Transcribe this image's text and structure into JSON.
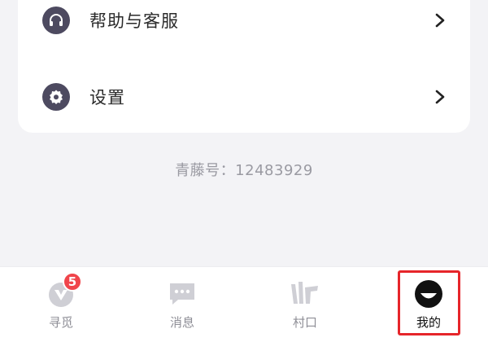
{
  "menu": {
    "help_label": "帮助与客服",
    "settings_label": "设置"
  },
  "footer": {
    "id_text": "青藤号：12483929"
  },
  "tabbar": {
    "tabs": [
      {
        "label": "寻觅",
        "icon": "discover-icon",
        "badge": "5"
      },
      {
        "label": "消息",
        "icon": "message-icon"
      },
      {
        "label": "村口",
        "icon": "village-icon"
      },
      {
        "label": "我的",
        "icon": "profile-icon",
        "active": true
      }
    ]
  },
  "colors": {
    "icon_bg": "#4d4a60",
    "badge": "#f0454b",
    "highlight": "#e6252a",
    "page_bg": "#f3f3f6"
  }
}
